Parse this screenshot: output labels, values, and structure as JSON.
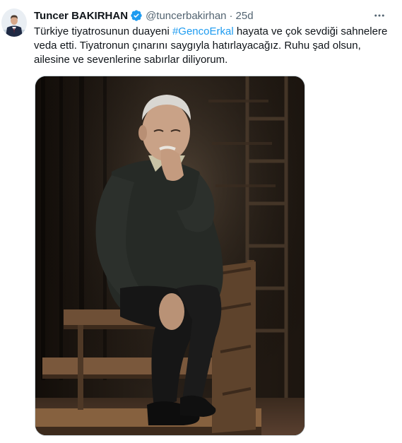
{
  "author": {
    "name": "Tuncer BAKIRHAN",
    "handle": "@tuncerbakirhan",
    "separator": "·",
    "time": "25d",
    "avatar_icon": "profile-photo"
  },
  "verified_icon": "verified-badge-icon",
  "more_icon": "more-dots-icon",
  "tweet": {
    "line1_before": "Türkiye tiyatrosunun duayeni ",
    "hashtag": "#GencoErkal",
    "line1_after": " hayata ve çok sevdiği sahnelere",
    "line2": "veda etti. Tiyatronun çınarını saygıyla hatırlayacağız.  Ruhu şad olsun,",
    "line3": "ailesine ve sevenlerine sabırlar diliyorum."
  },
  "media": {
    "description_icon": "photo-elderly-man-seated-on-wooden-stage-steps"
  },
  "colors": {
    "text": "#0f1419",
    "secondary": "#536471",
    "accent": "#1d9bf0",
    "border": "#cfd9de"
  }
}
